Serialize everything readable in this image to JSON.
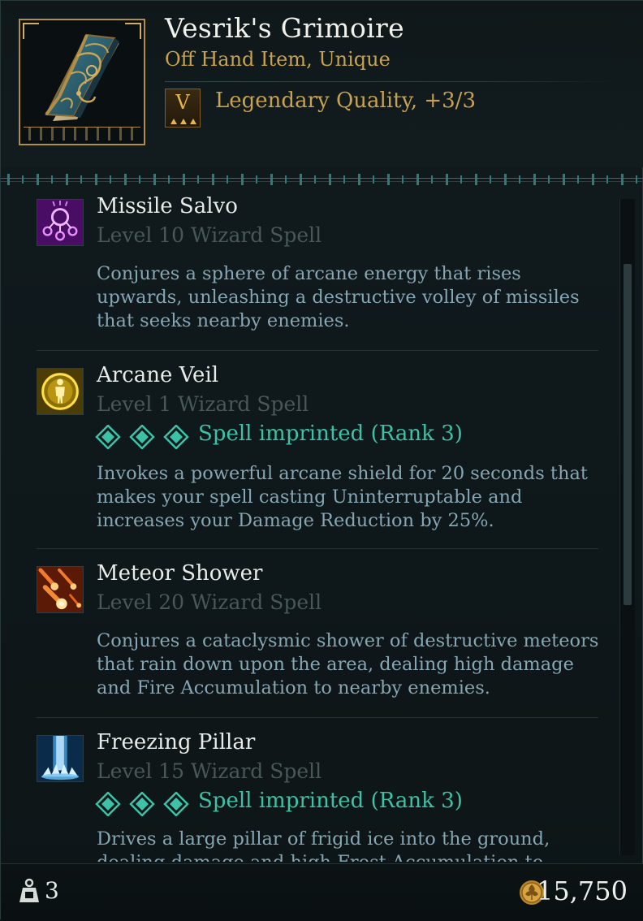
{
  "item": {
    "name": "Vesrik's Grimoire",
    "type": "Off Hand Item, Unique",
    "quality_badge": "V",
    "quality_text": "Legendary Quality, +3/3",
    "icon": "grimoire-book-icon"
  },
  "spells": [
    {
      "name": "Missile Salvo",
      "level": "Level 10 Wizard Spell",
      "imprint": null,
      "description": "Conjures a sphere of arcane energy that rises upwards, unleashing a destructive volley of missiles that seeks nearby enemies.",
      "icon": "missile-salvo-icon",
      "color": "#7a1fa0"
    },
    {
      "name": "Arcane Veil",
      "level": "Level 1 Wizard Spell",
      "imprint": "Spell imprinted (Rank 3)",
      "description": "Invokes a powerful arcane shield for 20 seconds that makes your spell casting Uninterruptable and increases your Damage Reduction by 25%.",
      "icon": "arcane-veil-icon",
      "color": "#c9a414"
    },
    {
      "name": "Meteor Shower",
      "level": "Level 20 Wizard Spell",
      "imprint": null,
      "description": "Conjures a cataclysmic shower of destructive meteors that rain down upon the area, dealing high damage and Fire Accumulation to nearby enemies.",
      "icon": "meteor-shower-icon",
      "color": "#b23a12"
    },
    {
      "name": "Freezing Pillar",
      "level": "Level 15 Wizard Spell",
      "imprint": "Spell imprinted (Rank 3)",
      "description": "Drives a large pillar of frigid ice into the ground, dealing damage and high Frost Accumulation to nearby enemies.",
      "icon": "freezing-pillar-icon",
      "color": "#2a8fd0"
    }
  ],
  "footer": {
    "weight": "3",
    "gold": "15,750"
  },
  "colors": {
    "unique_gold": "#c8a24c",
    "imprint_teal": "#3cc2a7",
    "description_blue": "#86a6b3"
  }
}
